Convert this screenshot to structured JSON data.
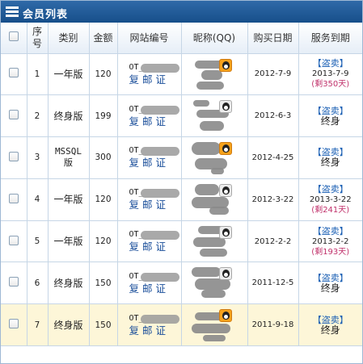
{
  "title": "会员列表",
  "columns": [
    "序号",
    "类别",
    "金额",
    "网站编号",
    "昵称(QQ)",
    "购买日期",
    "服务到期"
  ],
  "actions": {
    "copy": "复",
    "mail": "邮",
    "cert": "证"
  },
  "pirate_label": "【盗卖】",
  "rows": [
    {
      "no": "1",
      "type": "一年版",
      "amount": "120",
      "code": "OT_",
      "qq_online": true,
      "buy_date": "2012-7-9",
      "expire": "2013-7-9",
      "remaining": "(剩350天)"
    },
    {
      "no": "2",
      "type": "终身版",
      "amount": "199",
      "code": "OT_",
      "qq_online": false,
      "buy_date": "2012-6-3",
      "expire": "终身",
      "remaining": ""
    },
    {
      "no": "3",
      "type": "MSSQL版",
      "amount": "300",
      "code": "OT_",
      "qq_online": true,
      "buy_date": "2012-4-25",
      "expire": "终身",
      "remaining": ""
    },
    {
      "no": "4",
      "type": "一年版",
      "amount": "120",
      "code": "OT_",
      "qq_online": false,
      "buy_date": "2012-3-22",
      "expire": "2013-3-22",
      "remaining": "(剩241天)"
    },
    {
      "no": "5",
      "type": "一年版",
      "amount": "120",
      "code": "OT_",
      "qq_online": false,
      "buy_date": "2012-2-2",
      "expire": "2013-2-2",
      "remaining": "(剩193天)"
    },
    {
      "no": "6",
      "type": "终身版",
      "amount": "150",
      "code": "OT_",
      "qq_online": false,
      "buy_date": "2011-12-5",
      "expire": "终身",
      "remaining": ""
    },
    {
      "no": "7",
      "type": "终身版",
      "amount": "150",
      "code": "OT_",
      "qq_online": true,
      "buy_date": "2011-9-18",
      "expire": "终身",
      "remaining": ""
    }
  ]
}
